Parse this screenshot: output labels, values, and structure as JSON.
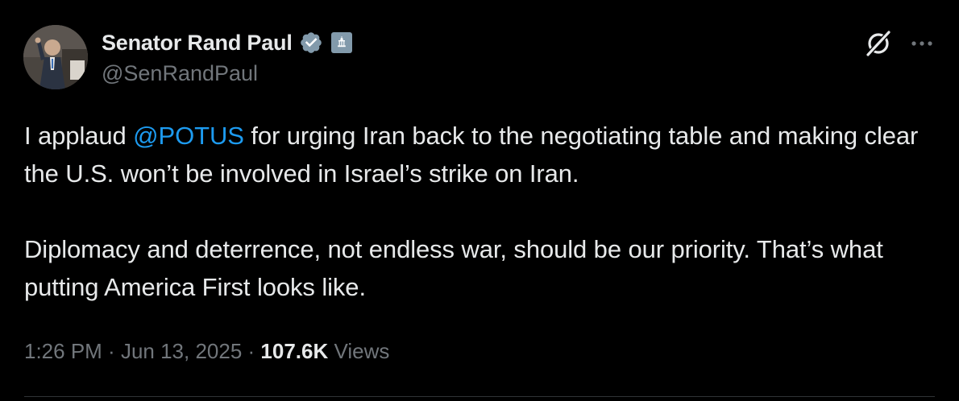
{
  "author": {
    "display_name": "Senator Rand Paul",
    "handle": "@SenRandPaul",
    "verified_badge": "verified-check-icon",
    "affiliation_badge": "government-building-icon"
  },
  "tweet": {
    "line1_pre": "I applaud ",
    "mention": "@POTUS",
    "line1_post": " for urging Iran back to the negotiating table and making clear the U.S. won’t be involved in Israel’s strike on Iran.",
    "paragraph2": "Diplomacy and deterrence, not endless war, should be our priority. That’s what putting America First looks like."
  },
  "meta": {
    "time": "1:26 PM",
    "sep1": " · ",
    "date": "Jun 13, 2025",
    "sep2": " · ",
    "views_count": "107.6K",
    "views_label": " Views"
  },
  "icons": {
    "grok": "grok-icon",
    "more": "more-options-icon"
  },
  "colors": {
    "background": "#000000",
    "text_primary": "#e7e9ea",
    "text_secondary": "#71767b",
    "link": "#1d9bf0",
    "verified": "#1d9bf0",
    "gov_badge": "#829aab"
  }
}
